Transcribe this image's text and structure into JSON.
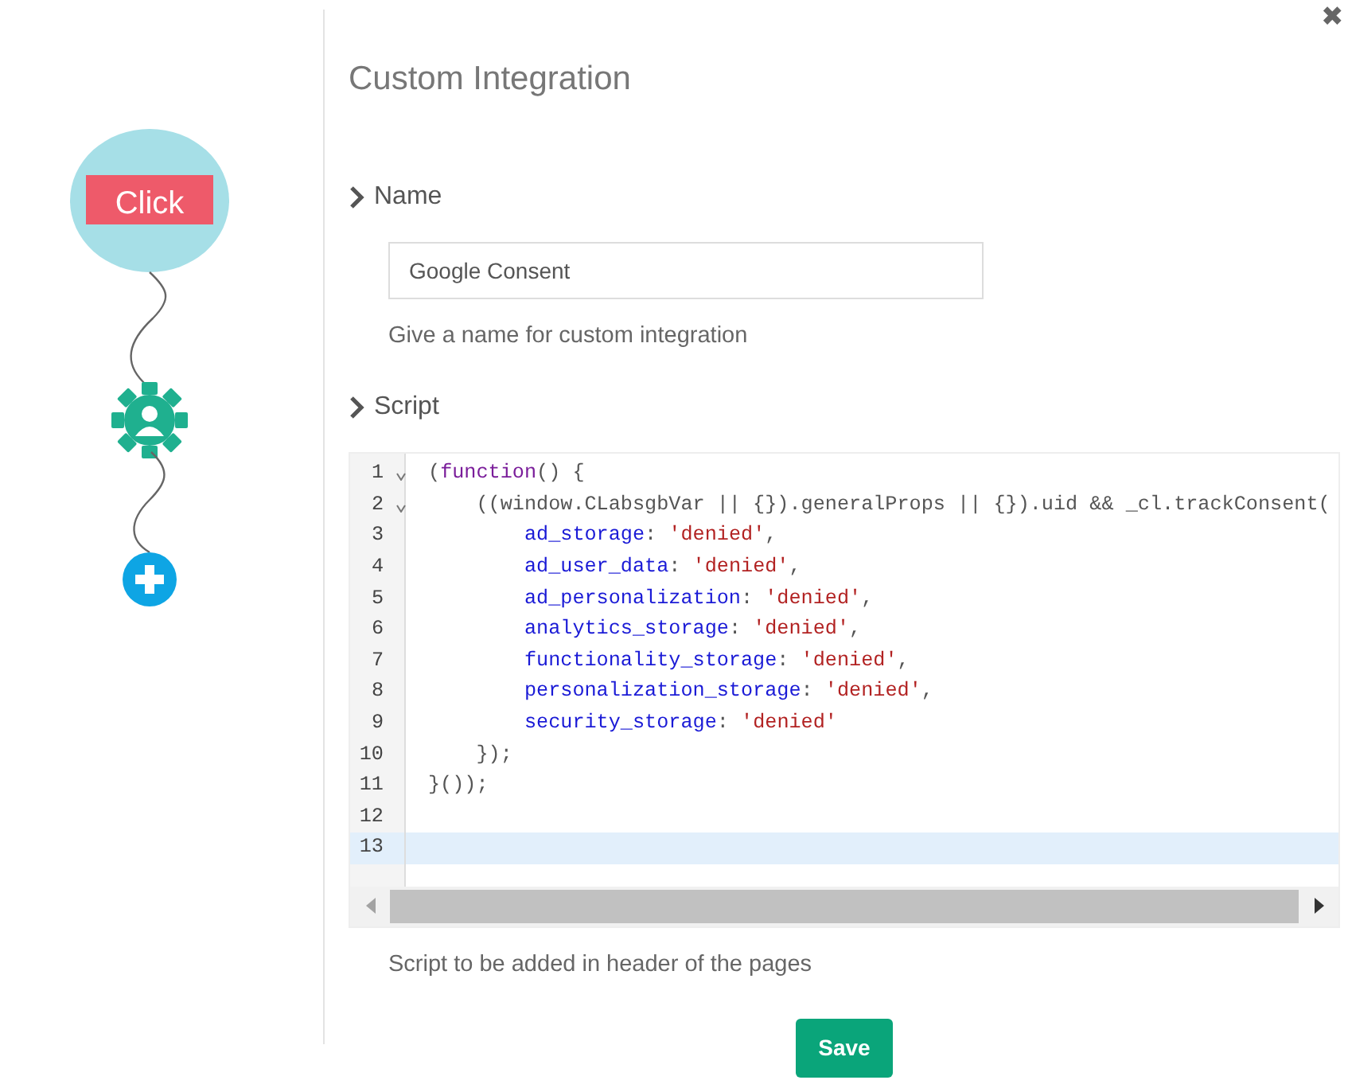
{
  "flow": {
    "nodes": [
      {
        "kind": "trigger",
        "label": "Click"
      },
      {
        "kind": "action"
      },
      {
        "kind": "add"
      }
    ]
  },
  "panel": {
    "title": "Custom Integration",
    "close": "✖",
    "sections": [
      {
        "kind": "name",
        "heading": "Name",
        "field": {
          "value": "Google Consent"
        },
        "help": "Give a name for custom integration"
      },
      {
        "kind": "script",
        "heading": "Script",
        "editor": {
          "lines": [
            {
              "number": "1",
              "foldable": true,
              "active": false,
              "tokens": [
                {
                  "kind": "plain",
                  "s": "("
                },
                {
                  "kind": "keyword",
                  "s": "function"
                },
                {
                  "kind": "plain",
                  "s": "() {"
                }
              ]
            },
            {
              "number": "2",
              "foldable": true,
              "active": false,
              "tokens": [
                {
                  "kind": "plain",
                  "s": "    ((window.CLabsgbVar || {}).generalProps || {}).uid && _cl.trackConsent("
                }
              ]
            },
            {
              "number": "3",
              "foldable": false,
              "active": false,
              "tokens": [
                {
                  "kind": "prop",
                  "s": "        ad_storage"
                },
                {
                  "kind": "plain",
                  "s": ": "
                },
                {
                  "kind": "string",
                  "s": "'denied'"
                },
                {
                  "kind": "plain",
                  "s": ","
                }
              ]
            },
            {
              "number": "4",
              "foldable": false,
              "active": false,
              "tokens": [
                {
                  "kind": "prop",
                  "s": "        ad_user_data"
                },
                {
                  "kind": "plain",
                  "s": ": "
                },
                {
                  "kind": "string",
                  "s": "'denied'"
                },
                {
                  "kind": "plain",
                  "s": ","
                }
              ]
            },
            {
              "number": "5",
              "foldable": false,
              "active": false,
              "tokens": [
                {
                  "kind": "prop",
                  "s": "        ad_personalization"
                },
                {
                  "kind": "plain",
                  "s": ": "
                },
                {
                  "kind": "string",
                  "s": "'denied'"
                },
                {
                  "kind": "plain",
                  "s": ","
                }
              ]
            },
            {
              "number": "6",
              "foldable": false,
              "active": false,
              "tokens": [
                {
                  "kind": "prop",
                  "s": "        analytics_storage"
                },
                {
                  "kind": "plain",
                  "s": ": "
                },
                {
                  "kind": "string",
                  "s": "'denied'"
                },
                {
                  "kind": "plain",
                  "s": ","
                }
              ]
            },
            {
              "number": "7",
              "foldable": false,
              "active": false,
              "tokens": [
                {
                  "kind": "prop",
                  "s": "        functionality_storage"
                },
                {
                  "kind": "plain",
                  "s": ": "
                },
                {
                  "kind": "string",
                  "s": "'denied'"
                },
                {
                  "kind": "plain",
                  "s": ","
                }
              ]
            },
            {
              "number": "8",
              "foldable": false,
              "active": false,
              "tokens": [
                {
                  "kind": "prop",
                  "s": "        personalization_storage"
                },
                {
                  "kind": "plain",
                  "s": ": "
                },
                {
                  "kind": "string",
                  "s": "'denied'"
                },
                {
                  "kind": "plain",
                  "s": ","
                }
              ]
            },
            {
              "number": "9",
              "foldable": false,
              "active": false,
              "tokens": [
                {
                  "kind": "prop",
                  "s": "        security_storage"
                },
                {
                  "kind": "plain",
                  "s": ": "
                },
                {
                  "kind": "string",
                  "s": "'denied'"
                }
              ]
            },
            {
              "number": "10",
              "foldable": false,
              "active": false,
              "tokens": [
                {
                  "kind": "plain",
                  "s": "    });"
                }
              ]
            },
            {
              "number": "11",
              "foldable": false,
              "active": false,
              "tokens": [
                {
                  "kind": "plain",
                  "s": "}());"
                }
              ]
            },
            {
              "number": "12",
              "foldable": false,
              "active": false
            },
            {
              "number": "13",
              "foldable": false,
              "active": true
            }
          ]
        },
        "help": "Script to be added in header of the pages"
      }
    ],
    "save": "Save"
  }
}
